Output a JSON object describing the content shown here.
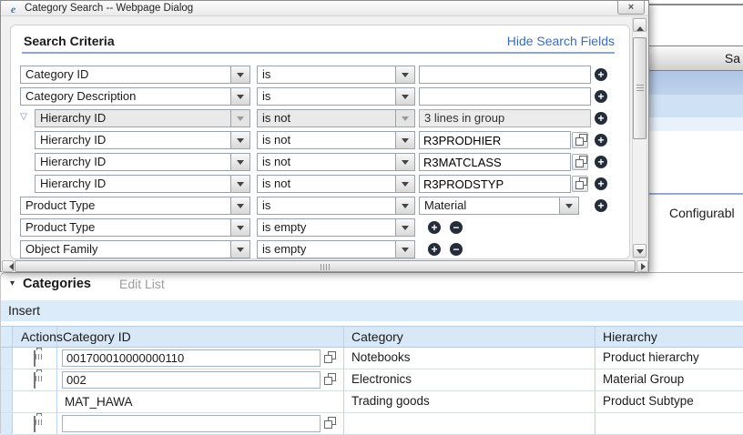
{
  "window": {
    "title": "Category Search -- Webpage Dialog"
  },
  "dialog": {
    "section_title": "Search Criteria",
    "hide_search_fields_label": "Hide Search Fields",
    "criteria_rows": [
      {
        "attribute": "Category ID",
        "operator": "is",
        "value": ""
      },
      {
        "attribute": "Category Description",
        "operator": "is",
        "value": ""
      },
      {
        "attribute": "Hierarchy ID",
        "operator": "is not",
        "group_summary": "3 lines in group"
      },
      {
        "attribute": "Hierarchy ID",
        "operator": "is not",
        "value": "R3PRODHIER"
      },
      {
        "attribute": "Hierarchy ID",
        "operator": "is not",
        "value": "R3MATCLASS"
      },
      {
        "attribute": "Hierarchy ID",
        "operator": "is not",
        "value": "R3PRODSTYP"
      },
      {
        "attribute": "Product Type",
        "operator": "is",
        "value": "Material"
      },
      {
        "attribute": "Product Type",
        "operator": "is empty"
      },
      {
        "attribute": "Object Family",
        "operator": "is empty"
      }
    ]
  },
  "background_page": {
    "save_button_label": "Sa",
    "configurable_tab_label": "Configurabl"
  },
  "categories_section": {
    "title": "Categories",
    "edit_list_label": "Edit List",
    "insert_label": "Insert",
    "columns": {
      "actions": "Actions",
      "category_id": "Category ID",
      "category": "Category",
      "hierarchy": "Hierarchy"
    },
    "rows": [
      {
        "category_id": "001700010000000110",
        "category": "Notebooks",
        "hierarchy": "Product hierarchy"
      },
      {
        "category_id": "002",
        "category": "Electronics",
        "hierarchy": "Material Group"
      },
      {
        "category_id": "MAT_HAWA",
        "category": "Trading goods",
        "hierarchy": "Product Subtype"
      },
      {
        "category_id": "",
        "category": "",
        "hierarchy": ""
      }
    ]
  },
  "icons": {
    "expander_open": "▽",
    "section_collapse": "▾",
    "plus": "+",
    "minus": "−",
    "close": "×",
    "ie_logo": "e"
  },
  "colors": {
    "link_blue": "#3f6cb5",
    "rule_blue": "#8ba6d8",
    "table_header_bg": "#d9e8f7",
    "toolbar_bg": "#dcebf9",
    "circle_button_bg": "#242d39",
    "band_blue": "#b3c9e6"
  }
}
